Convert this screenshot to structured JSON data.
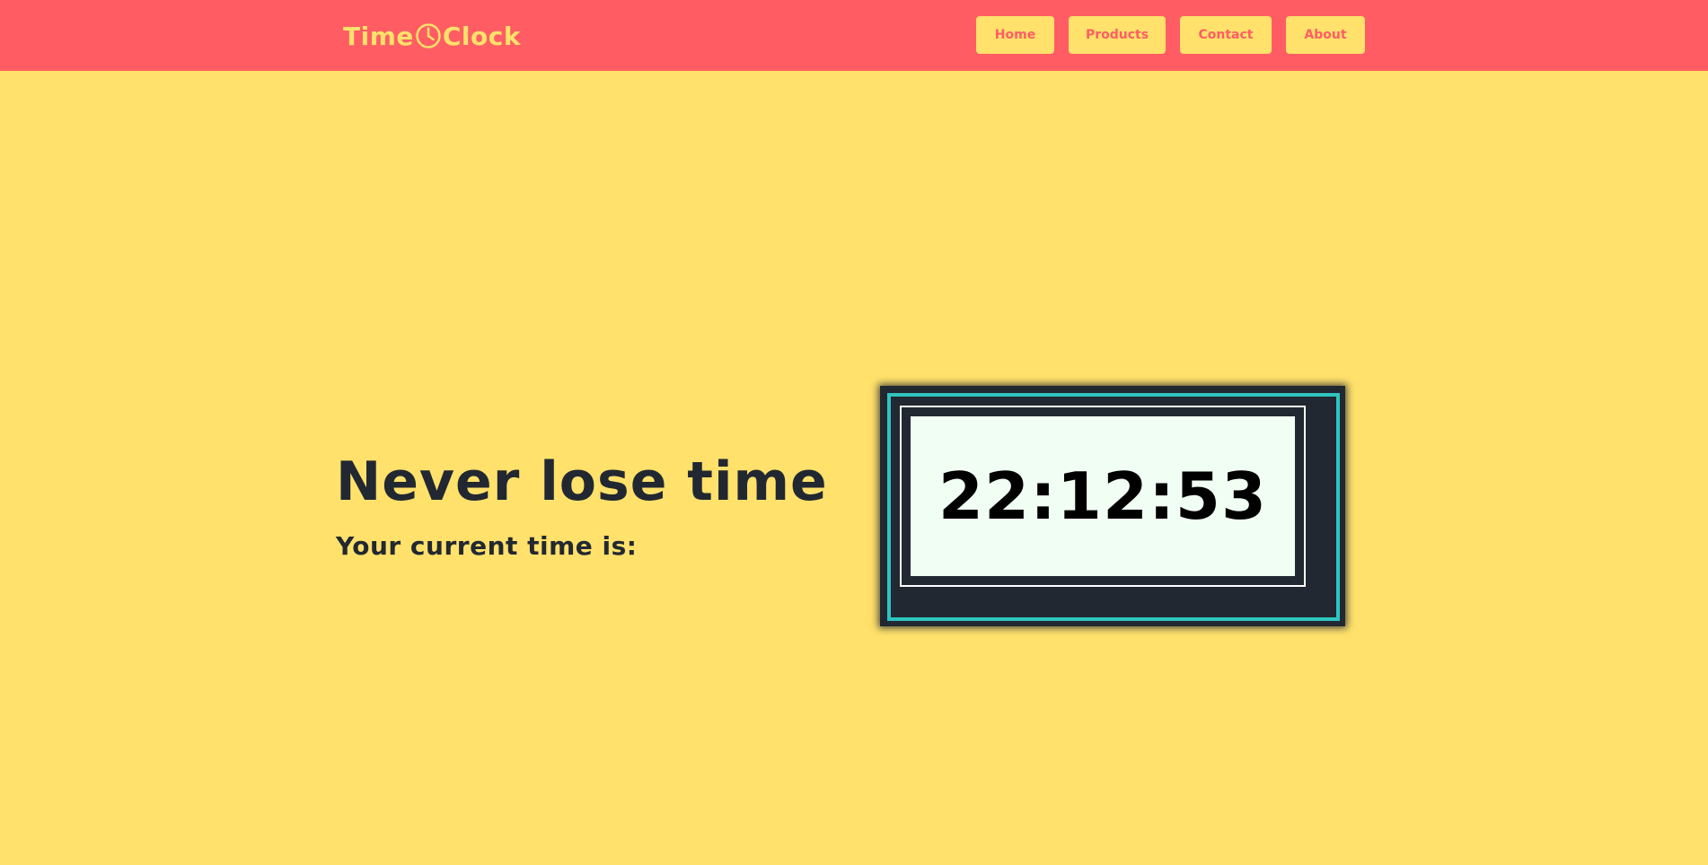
{
  "navbar": {
    "brand": {
      "part1": "Time",
      "part2": "Clock",
      "icon": "clock-icon"
    },
    "items": [
      {
        "label": "Home"
      },
      {
        "label": "Products"
      },
      {
        "label": "Contact"
      },
      {
        "label": "About"
      }
    ]
  },
  "hero": {
    "title": "Never lose time",
    "subtitle": "Your current time is:"
  },
  "clock": {
    "time": "22:12:53"
  },
  "colors": {
    "navbar_bg": "#ff5d63",
    "page_bg": "#ffe16b",
    "text_dark": "#222831",
    "clock_border_teal": "#2fc4bf",
    "clock_face": "#f1fef4"
  }
}
